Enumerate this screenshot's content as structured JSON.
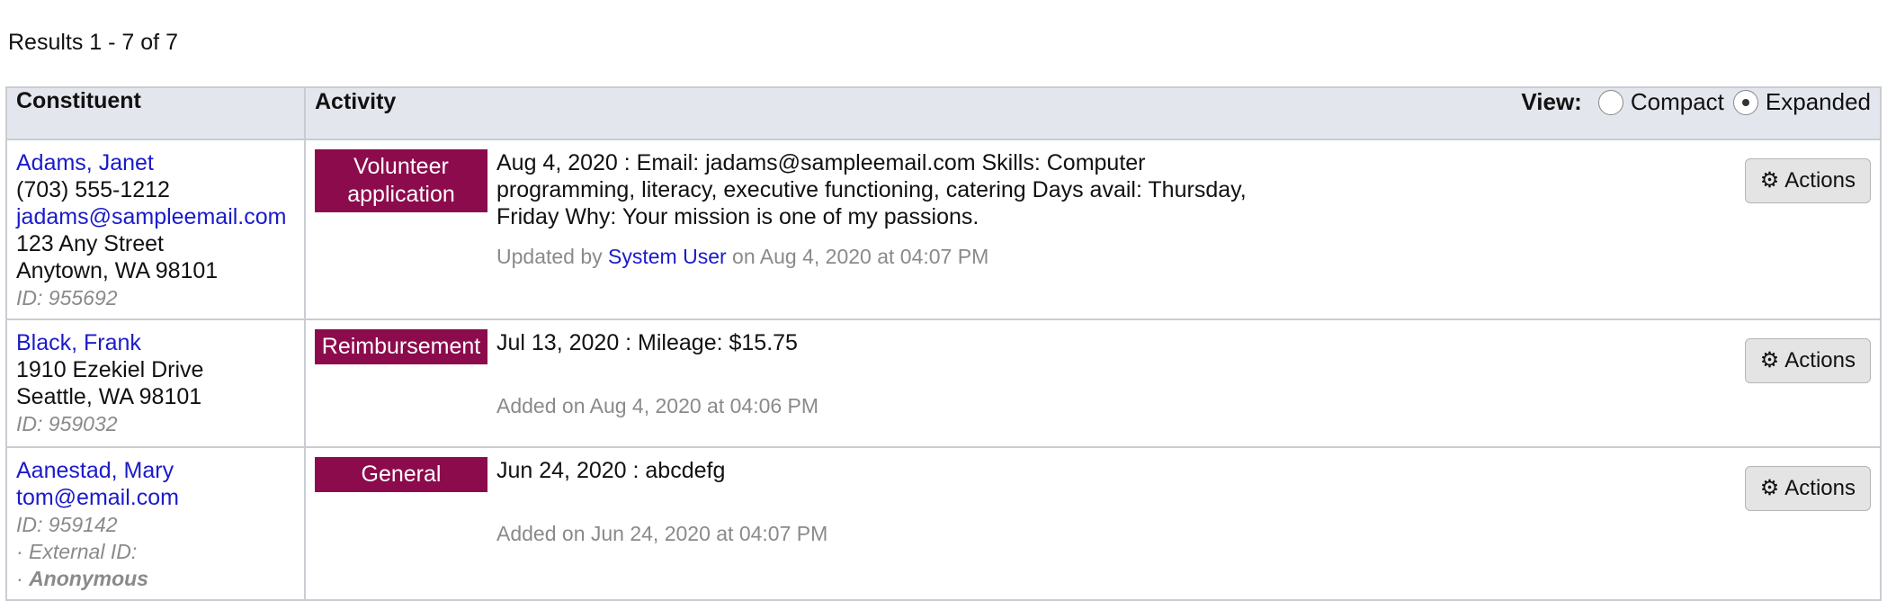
{
  "results_text": "Results 1 - 7 of 7",
  "table": {
    "headers": {
      "constituent": "Constituent",
      "activity": "Activity"
    },
    "view": {
      "label": "View:",
      "options": [
        {
          "label": "Compact",
          "selected": false
        },
        {
          "label": "Expanded",
          "selected": true
        }
      ]
    },
    "action_label": "Actions",
    "action_icon": "gear-icon",
    "badge_color": "#8c0b4c",
    "rows": [
      {
        "name": "Adams, Janet",
        "phone": "(703) 555-1212",
        "email": "jadams@sampleemail.com",
        "street": "123 Any Street",
        "city": "Anytown, WA 98101",
        "id": "ID: 955692",
        "activity": {
          "type": "Volunteer application",
          "description": "Aug 4, 2020 : Email: jadams@sampleemail.com Skills: Computer programming, literacy, executive functioning, catering Days avail: Thursday, Friday Why: Your mission is one of my passions.",
          "meta_prefix": "Updated by ",
          "meta_user": "System User",
          "meta_suffix": " on Aug 4, 2020 at 04:07 PM"
        }
      },
      {
        "name": "Black, Frank",
        "street": "1910 Ezekiel Drive",
        "city": "Seattle, WA 98101",
        "id": "ID: 959032",
        "activity": {
          "type": "Reimbursement",
          "description": "Jul 13, 2020 : Mileage: $15.75",
          "meta": "Added on Aug 4, 2020 at 04:06 PM"
        }
      },
      {
        "name": "Aanestad, Mary",
        "email": "tom@email.com",
        "id": "ID: 959142",
        "external_id": "· External ID:",
        "anon_prefix": "· ",
        "anon": "Anonymous",
        "activity": {
          "type": "General",
          "description": "Jun 24, 2020 : abcdefg",
          "meta": "Added on Jun 24, 2020 at 04:07 PM"
        }
      }
    ]
  }
}
